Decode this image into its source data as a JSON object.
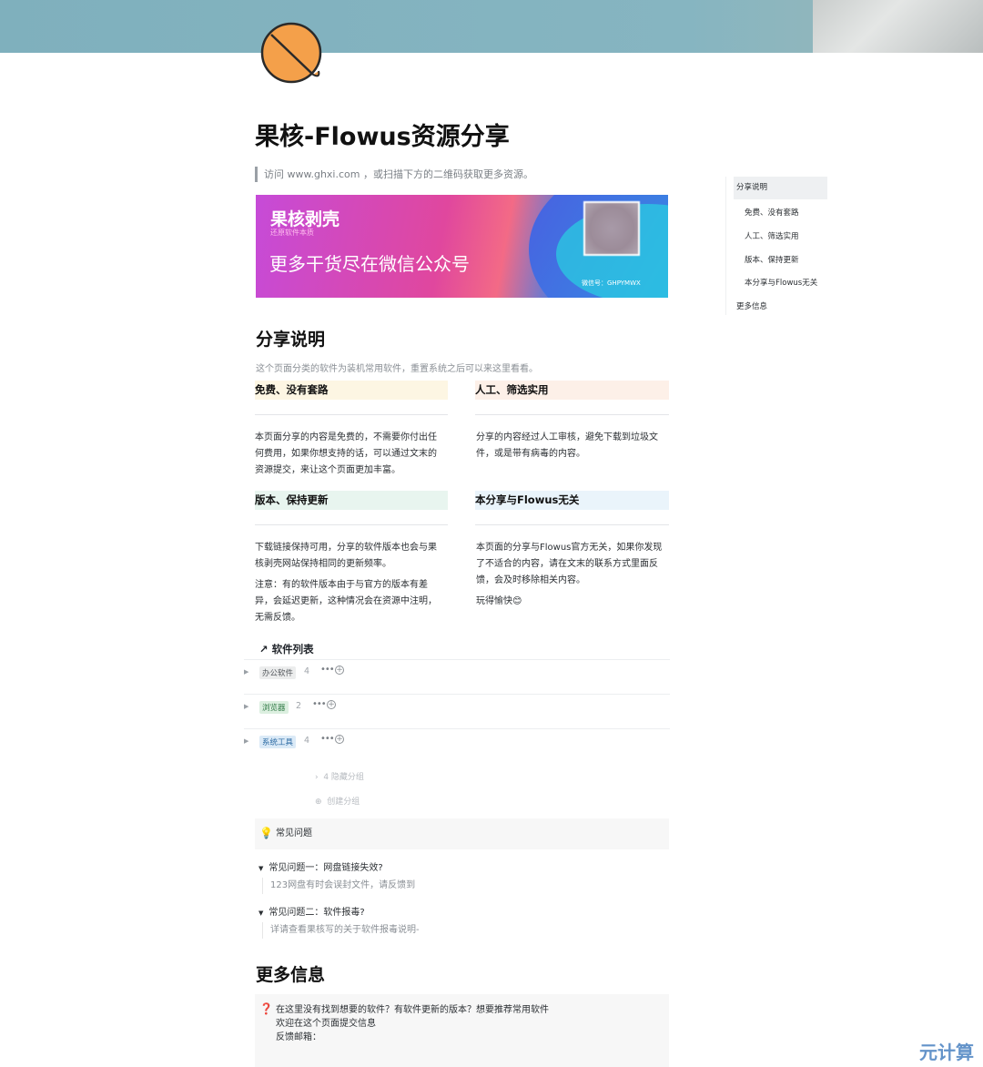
{
  "page": {
    "title": "果核-Flowus资源分享",
    "quote": "访问 www.ghxi.com ，或扫描下方的二维码获取更多资源。",
    "icon": "orange-slice-icon"
  },
  "banner": {
    "title": "果核剥壳",
    "subtitle": "还原软件本质",
    "main": "更多干货尽在微信公众号",
    "wechat": "微信号：GHPYMWX"
  },
  "share": {
    "heading": "分享说明",
    "intro": "这个页面分类的软件为装机常用软件，重置系统之后可以来这里看看。",
    "cards": [
      {
        "title": "免费、没有套路",
        "color": "#fdf6e3",
        "lines": [
          "本页面分享的内容是免费的，不需要你付出任",
          "何费用，如果你想支持的话，可以通过文末的",
          "资源提交，来让这个页面更加丰富。"
        ]
      },
      {
        "title": "人工、筛选实用",
        "color": "#fdf0e8",
        "lines": [
          "分享的内容经过人工审核，避免下载到垃圾文",
          "件，或是带有病毒的内容。"
        ]
      },
      {
        "title": "版本、保持更新",
        "color": "#e8f5ef",
        "lines": [
          "下载链接保持可用，分享的软件版本也会与果",
          "核剥壳网站保持相同的更新频率。"
        ],
        "lines2": [
          "注意：有的软件版本由于与官方的版本有差",
          "异，会延迟更新，这种情况会在资源中注明，",
          "无需反馈。"
        ]
      },
      {
        "title": "本分享与Flowus无关",
        "color": "#eaf4fb",
        "lines": [
          "本页面的分享与Flowus官方无关，如果你发现",
          "了不适合的内容，请在文末的联系方式里面反",
          "馈，会及时移除相关内容。"
        ],
        "lines2": [
          "玩得愉快😊"
        ]
      }
    ]
  },
  "software": {
    "title": "软件列表",
    "groups": [
      {
        "label": "办公软件",
        "count": "4",
        "bg": "#eceded",
        "fg": "#55595e"
      },
      {
        "label": "浏览器",
        "count": "2",
        "bg": "#dcefe0",
        "fg": "#2f7a45"
      },
      {
        "label": "系统工具",
        "count": "4",
        "bg": "#dbeaf7",
        "fg": "#2b6aa3"
      }
    ],
    "hidden_groups": "4 隐藏分组",
    "create_group": "创建分组"
  },
  "faq": {
    "callout": "常见问题",
    "items": [
      {
        "q": "常见问题一：网盘链接失效?",
        "a": "123网盘有时会误封文件，请反馈到"
      },
      {
        "q": "常见问题二：软件报毒?",
        "a": "详请查看果核写的关于软件报毒说明-"
      }
    ]
  },
  "more": {
    "heading": "更多信息",
    "lines": [
      "在这里没有找到想要的软件？有软件更新的版本？想要推荐常用软件",
      "欢迎在这个页面提交信息",
      "反馈邮箱："
    ]
  },
  "toc": {
    "items": [
      "分享说明",
      "免费、没有套路",
      "人工、筛选实用",
      "版本、保持更新",
      "本分享与Flowus无关",
      "更多信息"
    ]
  },
  "watermark": "元计算"
}
